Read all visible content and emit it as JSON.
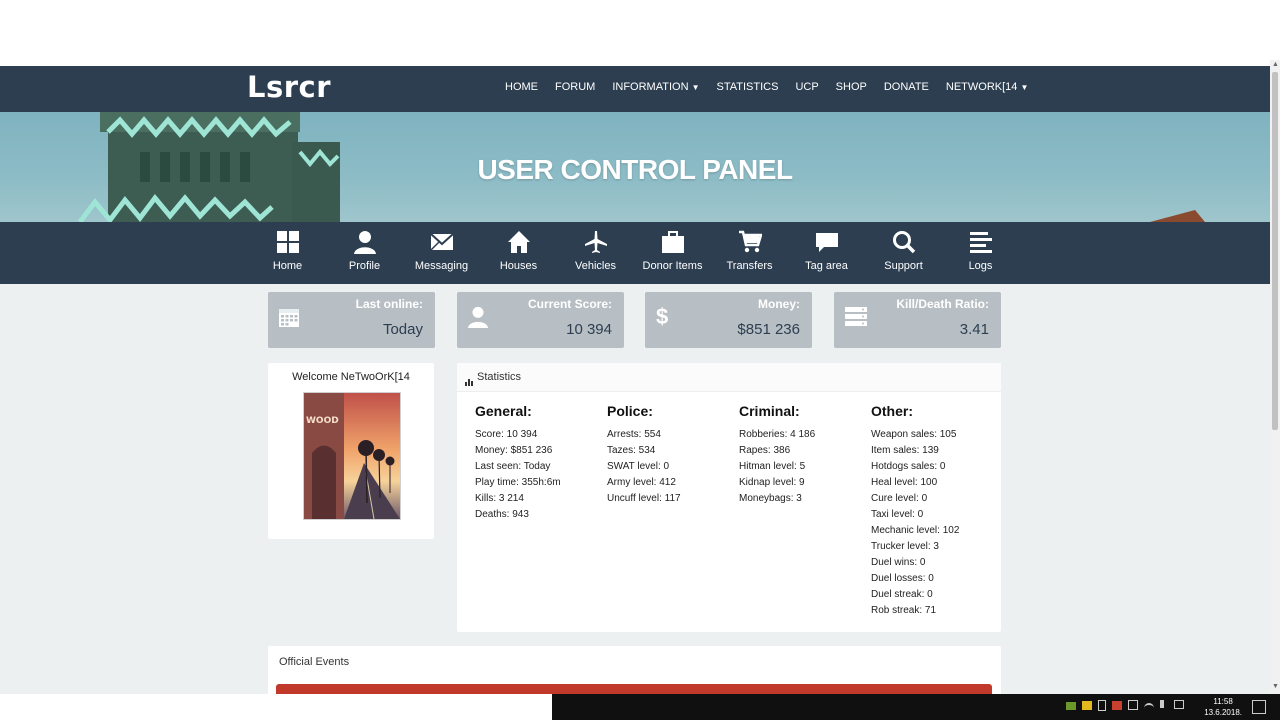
{
  "brand": "Lsrcr",
  "nav": [
    "HOME",
    "FORUM",
    "INFORMATION",
    "STATISTICS",
    "UCP",
    "SHOP",
    "DONATE",
    "NETWORK[14"
  ],
  "hero_title": "USER CONTROL PANEL",
  "icon_nav": [
    {
      "label": "Home",
      "icon": "grid-icon"
    },
    {
      "label": "Profile",
      "icon": "user-icon"
    },
    {
      "label": "Messaging",
      "icon": "envelope-icon"
    },
    {
      "label": "Houses",
      "icon": "house-icon"
    },
    {
      "label": "Vehicles",
      "icon": "plane-icon"
    },
    {
      "label": "Donor Items",
      "icon": "briefcase-icon"
    },
    {
      "label": "Transfers",
      "icon": "cart-icon"
    },
    {
      "label": "Tag area",
      "icon": "chat-icon"
    },
    {
      "label": "Support",
      "icon": "search-icon"
    },
    {
      "label": "Logs",
      "icon": "list-icon"
    }
  ],
  "cards": [
    {
      "label": "Last online:",
      "value": "Today",
      "icon": "calendar-icon"
    },
    {
      "label": "Current Score:",
      "value": "10 394",
      "icon": "user-icon"
    },
    {
      "label": "Money:",
      "value": "$851 236",
      "icon": "dollar-icon"
    },
    {
      "label": "Kill/Death Ratio:",
      "value": "3.41",
      "icon": "server-icon"
    }
  ],
  "welcome": "Welcome NeTwoOrK[14",
  "stats_title": "Statistics",
  "stats": {
    "general": {
      "title": "General:",
      "rows": [
        "Score: 10 394",
        "Money: $851 236",
        "Last seen: Today",
        "Play time: 355h:6m",
        "Kills: 3 214",
        "Deaths: 943"
      ]
    },
    "police": {
      "title": "Police:",
      "rows": [
        "Arrests: 554",
        "Tazes: 534",
        "SWAT level: 0",
        "Army level: 412",
        "Uncuff level: 117"
      ]
    },
    "criminal": {
      "title": "Criminal:",
      "rows": [
        "Robberies: 4 186",
        "Rapes: 386",
        "Hitman level: 5",
        "Kidnap level: 9",
        "Moneybags: 3"
      ]
    },
    "other": {
      "title": "Other:",
      "rows": [
        "Weapon sales: 105",
        "Item sales: 139",
        "Hotdogs sales: 0",
        "Heal level: 100",
        "Cure level: 0",
        "Taxi level: 0",
        "Mechanic level: 102",
        "Trucker level: 3",
        "Duel wins: 0",
        "Duel losses: 0",
        "Duel streak: 0",
        "Rob streak: 71"
      ]
    }
  },
  "events_title": "Official Events",
  "clock": {
    "time": "11:58",
    "date": "13.6.2018."
  },
  "colors": {
    "nav_bg": "#2c3e50",
    "card_bg": "#b7bec4",
    "page_bg": "#ecf0f1",
    "event_bar": "#c0392b"
  }
}
